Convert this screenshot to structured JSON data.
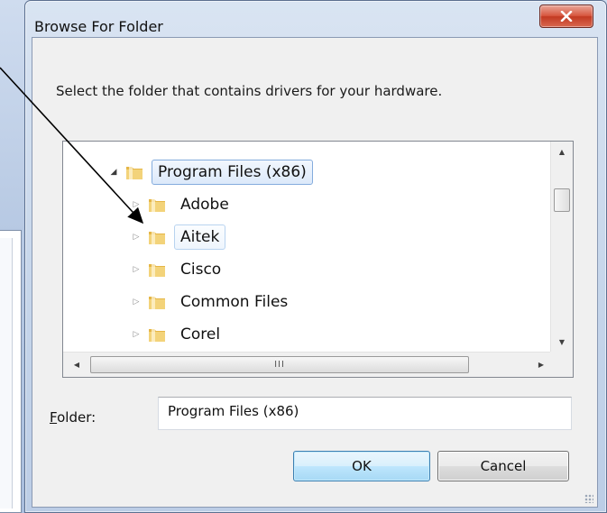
{
  "dialog": {
    "title": "Browse For Folder",
    "close_icon": "close-icon",
    "instruction": "Select the folder that contains drivers for your hardware.",
    "colors": {
      "close_red": "#d7573f",
      "selection_border": "#84acdd",
      "ok_border": "#3c7fb1"
    }
  },
  "tree": {
    "items": [
      {
        "label": "Program Files (x86)",
        "expanded": true,
        "selected": true
      },
      {
        "label": "Adobe",
        "expanded": false
      },
      {
        "label": "Aitek",
        "expanded": false,
        "hover": true
      },
      {
        "label": "Cisco",
        "expanded": false
      },
      {
        "label": "Common Files",
        "expanded": false
      },
      {
        "label": "Corel",
        "expanded": false
      }
    ],
    "hscroll_grip": "III"
  },
  "folder": {
    "label_accesskey": "F",
    "label_rest": "older:",
    "value": "Program Files (x86)"
  },
  "buttons": {
    "ok": "OK",
    "cancel": "Cancel"
  }
}
